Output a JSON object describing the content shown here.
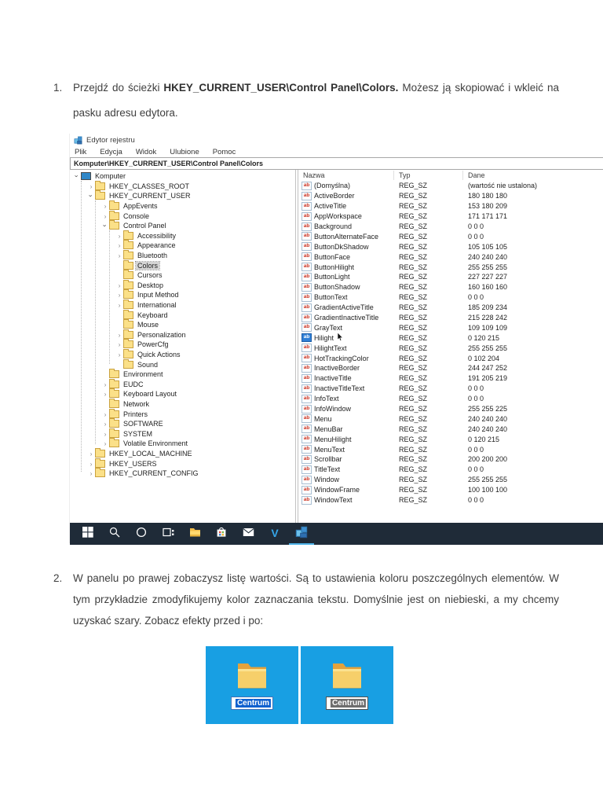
{
  "document": {
    "step1": {
      "number": "1.",
      "text_pre": "Przejdź do ścieżki ",
      "path_bold": "HKEY_CURRENT_USER\\Control Panel\\Colors.",
      "text_post": " Możesz ją skopiować i wkleić na pasku adresu edytora."
    },
    "step2": {
      "number": "2.",
      "text": "W panelu po prawej zobaczysz listę wartości. Są to ustawienia koloru poszczególnych elementów. W tym przykładzie zmodyfikujemy kolor zaznaczania tekstu. Domyślnie jest on niebieski, a my chcemy uzyskać szary. Zobacz efekty przed i po:"
    }
  },
  "regedit": {
    "window_title": "Edytor rejestru",
    "menu": [
      "Plik",
      "Edycja",
      "Widok",
      "Ulubione",
      "Pomoc"
    ],
    "address": "Komputer\\HKEY_CURRENT_USER\\Control Panel\\Colors",
    "columns": [
      "Nazwa",
      "Typ",
      "Dane"
    ],
    "tree": [
      {
        "label": "Komputer",
        "level": 0,
        "chev": "open",
        "icon": "computer"
      },
      {
        "label": "HKEY_CLASSES_ROOT",
        "level": 1,
        "chev": "closed",
        "icon": "folder"
      },
      {
        "label": "HKEY_CURRENT_USER",
        "level": 1,
        "chev": "open",
        "icon": "folder"
      },
      {
        "label": "AppEvents",
        "level": 2,
        "chev": "closed",
        "icon": "folder"
      },
      {
        "label": "Console",
        "level": 2,
        "chev": "closed",
        "icon": "folder"
      },
      {
        "label": "Control Panel",
        "level": 2,
        "chev": "open",
        "icon": "folder"
      },
      {
        "label": "Accessibility",
        "level": 3,
        "chev": "closed",
        "icon": "folder"
      },
      {
        "label": "Appearance",
        "level": 3,
        "chev": "closed",
        "icon": "folder"
      },
      {
        "label": "Bluetooth",
        "level": 3,
        "chev": "closed",
        "icon": "folder"
      },
      {
        "label": "Colors",
        "level": 3,
        "chev": "none",
        "icon": "folder",
        "selected": true
      },
      {
        "label": "Cursors",
        "level": 3,
        "chev": "none",
        "icon": "folder"
      },
      {
        "label": "Desktop",
        "level": 3,
        "chev": "closed",
        "icon": "folder"
      },
      {
        "label": "Input Method",
        "level": 3,
        "chev": "closed",
        "icon": "folder"
      },
      {
        "label": "International",
        "level": 3,
        "chev": "closed",
        "icon": "folder"
      },
      {
        "label": "Keyboard",
        "level": 3,
        "chev": "none",
        "icon": "folder"
      },
      {
        "label": "Mouse",
        "level": 3,
        "chev": "none",
        "icon": "folder"
      },
      {
        "label": "Personalization",
        "level": 3,
        "chev": "closed",
        "icon": "folder"
      },
      {
        "label": "PowerCfg",
        "level": 3,
        "chev": "closed",
        "icon": "folder"
      },
      {
        "label": "Quick Actions",
        "level": 3,
        "chev": "closed",
        "icon": "folder"
      },
      {
        "label": "Sound",
        "level": 3,
        "chev": "none",
        "icon": "folder"
      },
      {
        "label": "Environment",
        "level": 2,
        "chev": "none",
        "icon": "folder"
      },
      {
        "label": "EUDC",
        "level": 2,
        "chev": "closed",
        "icon": "folder"
      },
      {
        "label": "Keyboard Layout",
        "level": 2,
        "chev": "closed",
        "icon": "folder"
      },
      {
        "label": "Network",
        "level": 2,
        "chev": "none",
        "icon": "folder"
      },
      {
        "label": "Printers",
        "level": 2,
        "chev": "closed",
        "icon": "folder"
      },
      {
        "label": "SOFTWARE",
        "level": 2,
        "chev": "closed",
        "icon": "folder"
      },
      {
        "label": "SYSTEM",
        "level": 2,
        "chev": "closed",
        "icon": "folder"
      },
      {
        "label": "Volatile Environment",
        "level": 2,
        "chev": "closed",
        "icon": "folder"
      },
      {
        "label": "HKEY_LOCAL_MACHINE",
        "level": 1,
        "chev": "closed",
        "icon": "folder"
      },
      {
        "label": "HKEY_USERS",
        "level": 1,
        "chev": "closed",
        "icon": "folder"
      },
      {
        "label": "HKEY_CURRENT_CONFIG",
        "level": 1,
        "chev": "closed",
        "icon": "folder"
      }
    ],
    "values": [
      {
        "name": "(Domyślna)",
        "type": "REG_SZ",
        "data": "(wartość nie ustalona)"
      },
      {
        "name": "ActiveBorder",
        "type": "REG_SZ",
        "data": "180 180 180"
      },
      {
        "name": "ActiveTitle",
        "type": "REG_SZ",
        "data": "153 180 209"
      },
      {
        "name": "AppWorkspace",
        "type": "REG_SZ",
        "data": "171 171 171"
      },
      {
        "name": "Background",
        "type": "REG_SZ",
        "data": "0 0 0"
      },
      {
        "name": "ButtonAlternateFace",
        "type": "REG_SZ",
        "data": "0 0 0"
      },
      {
        "name": "ButtonDkShadow",
        "type": "REG_SZ",
        "data": "105 105 105"
      },
      {
        "name": "ButtonFace",
        "type": "REG_SZ",
        "data": "240 240 240"
      },
      {
        "name": "ButtonHilight",
        "type": "REG_SZ",
        "data": "255 255 255"
      },
      {
        "name": "ButtonLight",
        "type": "REG_SZ",
        "data": "227 227 227"
      },
      {
        "name": "ButtonShadow",
        "type": "REG_SZ",
        "data": "160 160 160"
      },
      {
        "name": "ButtonText",
        "type": "REG_SZ",
        "data": "0 0 0"
      },
      {
        "name": "GradientActiveTitle",
        "type": "REG_SZ",
        "data": "185 209 234"
      },
      {
        "name": "GradientInactiveTitle",
        "type": "REG_SZ",
        "data": "215 228 242"
      },
      {
        "name": "GrayText",
        "type": "REG_SZ",
        "data": "109 109 109"
      },
      {
        "name": "Hilight",
        "type": "REG_SZ",
        "data": "0 120 215",
        "selected": true,
        "cursor": true
      },
      {
        "name": "HilightText",
        "type": "REG_SZ",
        "data": "255 255 255"
      },
      {
        "name": "HotTrackingColor",
        "type": "REG_SZ",
        "data": "0 102 204"
      },
      {
        "name": "InactiveBorder",
        "type": "REG_SZ",
        "data": "244 247 252"
      },
      {
        "name": "InactiveTitle",
        "type": "REG_SZ",
        "data": "191 205 219"
      },
      {
        "name": "InactiveTitleText",
        "type": "REG_SZ",
        "data": "0 0 0"
      },
      {
        "name": "InfoText",
        "type": "REG_SZ",
        "data": "0 0 0"
      },
      {
        "name": "InfoWindow",
        "type": "REG_SZ",
        "data": "255 255 225"
      },
      {
        "name": "Menu",
        "type": "REG_SZ",
        "data": "240 240 240"
      },
      {
        "name": "MenuBar",
        "type": "REG_SZ",
        "data": "240 240 240"
      },
      {
        "name": "MenuHilight",
        "type": "REG_SZ",
        "data": "0 120 215"
      },
      {
        "name": "MenuText",
        "type": "REG_SZ",
        "data": "0 0 0"
      },
      {
        "name": "Scrollbar",
        "type": "REG_SZ",
        "data": "200 200 200"
      },
      {
        "name": "TitleText",
        "type": "REG_SZ",
        "data": "0 0 0"
      },
      {
        "name": "Window",
        "type": "REG_SZ",
        "data": "255 255 255"
      },
      {
        "name": "WindowFrame",
        "type": "REG_SZ",
        "data": "100 100 100"
      },
      {
        "name": "WindowText",
        "type": "REG_SZ",
        "data": "0 0 0"
      }
    ]
  },
  "taskbar": {
    "icons": [
      "start",
      "search",
      "cortana",
      "task-view",
      "file-explorer",
      "store",
      "mail",
      "vivaldi",
      "regedit"
    ],
    "active_icon": "regedit"
  },
  "before_after": {
    "tiles": [
      {
        "id": "before",
        "label": "Centrum",
        "selection": "blue"
      },
      {
        "id": "after",
        "label": "Centrum",
        "selection": "gray"
      }
    ]
  },
  "colors": {
    "selection_blue": "#1161cf",
    "selection_gray": "#6e6e6e",
    "tile_background": "#189fe3",
    "taskbar_background": "#1f2b38",
    "active_underline": "#4db2e8",
    "value_selected_icon": "#2f7fd6"
  }
}
